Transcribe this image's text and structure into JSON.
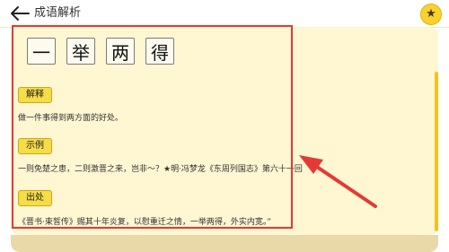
{
  "app": {
    "title": "成语解析"
  },
  "idiom": {
    "chars": [
      "一",
      "举",
      "两",
      "得"
    ]
  },
  "sections": [
    {
      "label": "解释",
      "text": "做一件事得到两方面的好处。"
    },
    {
      "label": "示例",
      "text": "一则免楚之患，二则激晋之来，岂非～？★明·冯梦龙《东周列国志》第六十一回"
    },
    {
      "label": "出处",
      "text": "《晋书·束皙传》赐其十年炎复，以慰重迁之情，一举两得，外实内宽。”"
    }
  ],
  "colors": {
    "accent": "#f5dc49",
    "card_bg": "#fff6d2",
    "annotation": "#e53935"
  },
  "icons": {
    "back": "arrow-left",
    "favorite": "star"
  }
}
